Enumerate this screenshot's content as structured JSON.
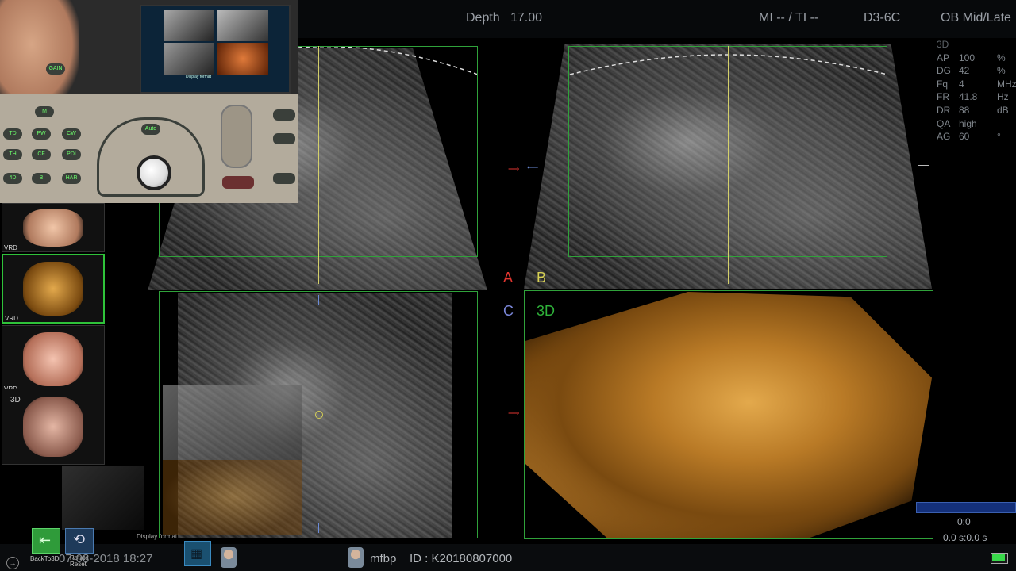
{
  "topbar": {
    "depth_label": "Depth",
    "depth_value": "17.00",
    "mi_ti": "MI -- / TI --",
    "probe": "D3-6C",
    "preset": "OB Mid/Late"
  },
  "params": {
    "mode": "3D",
    "rows": [
      {
        "k": "AP",
        "v": "100",
        "u": "%"
      },
      {
        "k": "DG",
        "v": "42",
        "u": "%"
      },
      {
        "k": "Fq",
        "v": "4",
        "u": "MHz"
      },
      {
        "k": "FR",
        "v": "41.8",
        "u": "Hz"
      },
      {
        "k": "DR",
        "v": "88",
        "u": "dB"
      },
      {
        "k": "QA",
        "v": "high",
        "u": ""
      },
      {
        "k": "AG",
        "v": "60",
        "u": "°"
      }
    ]
  },
  "panes": {
    "label_a": "A",
    "label_b": "B",
    "label_c": "C",
    "label_3d": "3D"
  },
  "colors": {
    "label_a": "#e0352f",
    "label_b": "#d6d054",
    "label_c": "#7a86d8",
    "label_3d": "#2fb23a",
    "box_green": "#2fa23a",
    "ref_line": "#d4d06a"
  },
  "thumbnails": [
    {
      "label": "VRD"
    },
    {
      "label": "VRD"
    },
    {
      "label": "VRD"
    },
    {
      "label": "3D"
    }
  ],
  "camera": {
    "screen_title": "Display format",
    "keys": [
      "TD",
      "PW",
      "CW",
      "TH",
      "CF",
      "PDI",
      "4D",
      "B",
      "HAR",
      "M",
      "Auto",
      "GAIN"
    ]
  },
  "bottom": {
    "back_label": "BackTo3D",
    "rotate_label": "Rotate Reset",
    "display_format": "Display format",
    "datetime": "07-08-2018 18:27",
    "user": "mfbp",
    "id_label": "ID : K20180807000"
  },
  "scale": {
    "value": "0:0",
    "time": "0.0 s:0.0 s"
  }
}
